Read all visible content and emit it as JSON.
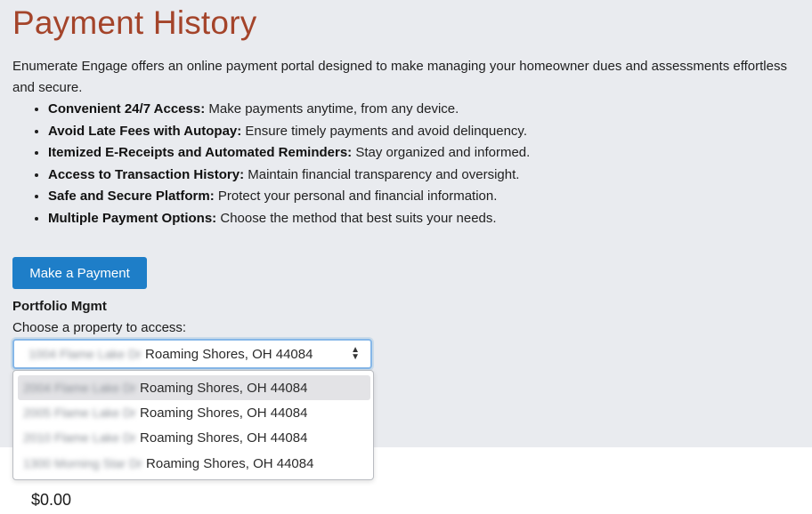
{
  "page": {
    "title": "Payment History",
    "intro": "Enumerate Engage offers an online payment portal designed to make managing your homeowner dues and assessments effortless and secure."
  },
  "features": [
    {
      "bold": "Convenient 24/7 Access:",
      "text": " Make payments anytime, from any device."
    },
    {
      "bold": "Avoid Late Fees with Autopay:",
      "text": " Ensure timely payments and avoid delinquency."
    },
    {
      "bold": "Itemized E-Receipts and Automated Reminders:",
      "text": " Stay organized and informed."
    },
    {
      "bold": "Access to Transaction History:",
      "text": " Maintain financial transparency and oversight."
    },
    {
      "bold": "Safe and Secure Platform:",
      "text": " Protect your personal and financial information."
    },
    {
      "bold": "Multiple Payment Options:",
      "text": " Choose the method that best suits your needs."
    }
  ],
  "actions": {
    "make_payment_label": "Make a Payment"
  },
  "property_selector": {
    "section_label": "Portfolio Mgmt",
    "prompt": "Choose a property to access:",
    "selected_city": "Roaming Shores, OH 44084",
    "selected_redacted": "1004 Flame Lake Dr",
    "options": [
      {
        "redacted": "2004 Flame Lake Dr",
        "city": "Roaming Shores, OH 44084"
      },
      {
        "redacted": "2005 Flame Lake Dr",
        "city": "Roaming Shores, OH 44084"
      },
      {
        "redacted": "2010 Flame Lake Dr",
        "city": "Roaming Shores, OH 44084"
      },
      {
        "redacted": "1300 Morning Star Dr",
        "city": "Roaming Shores, OH 44084"
      }
    ]
  },
  "balance": {
    "amount": "$0.00"
  },
  "colors": {
    "title": "#a4442a",
    "button": "#1e7ec8",
    "background": "#e9ebef"
  }
}
